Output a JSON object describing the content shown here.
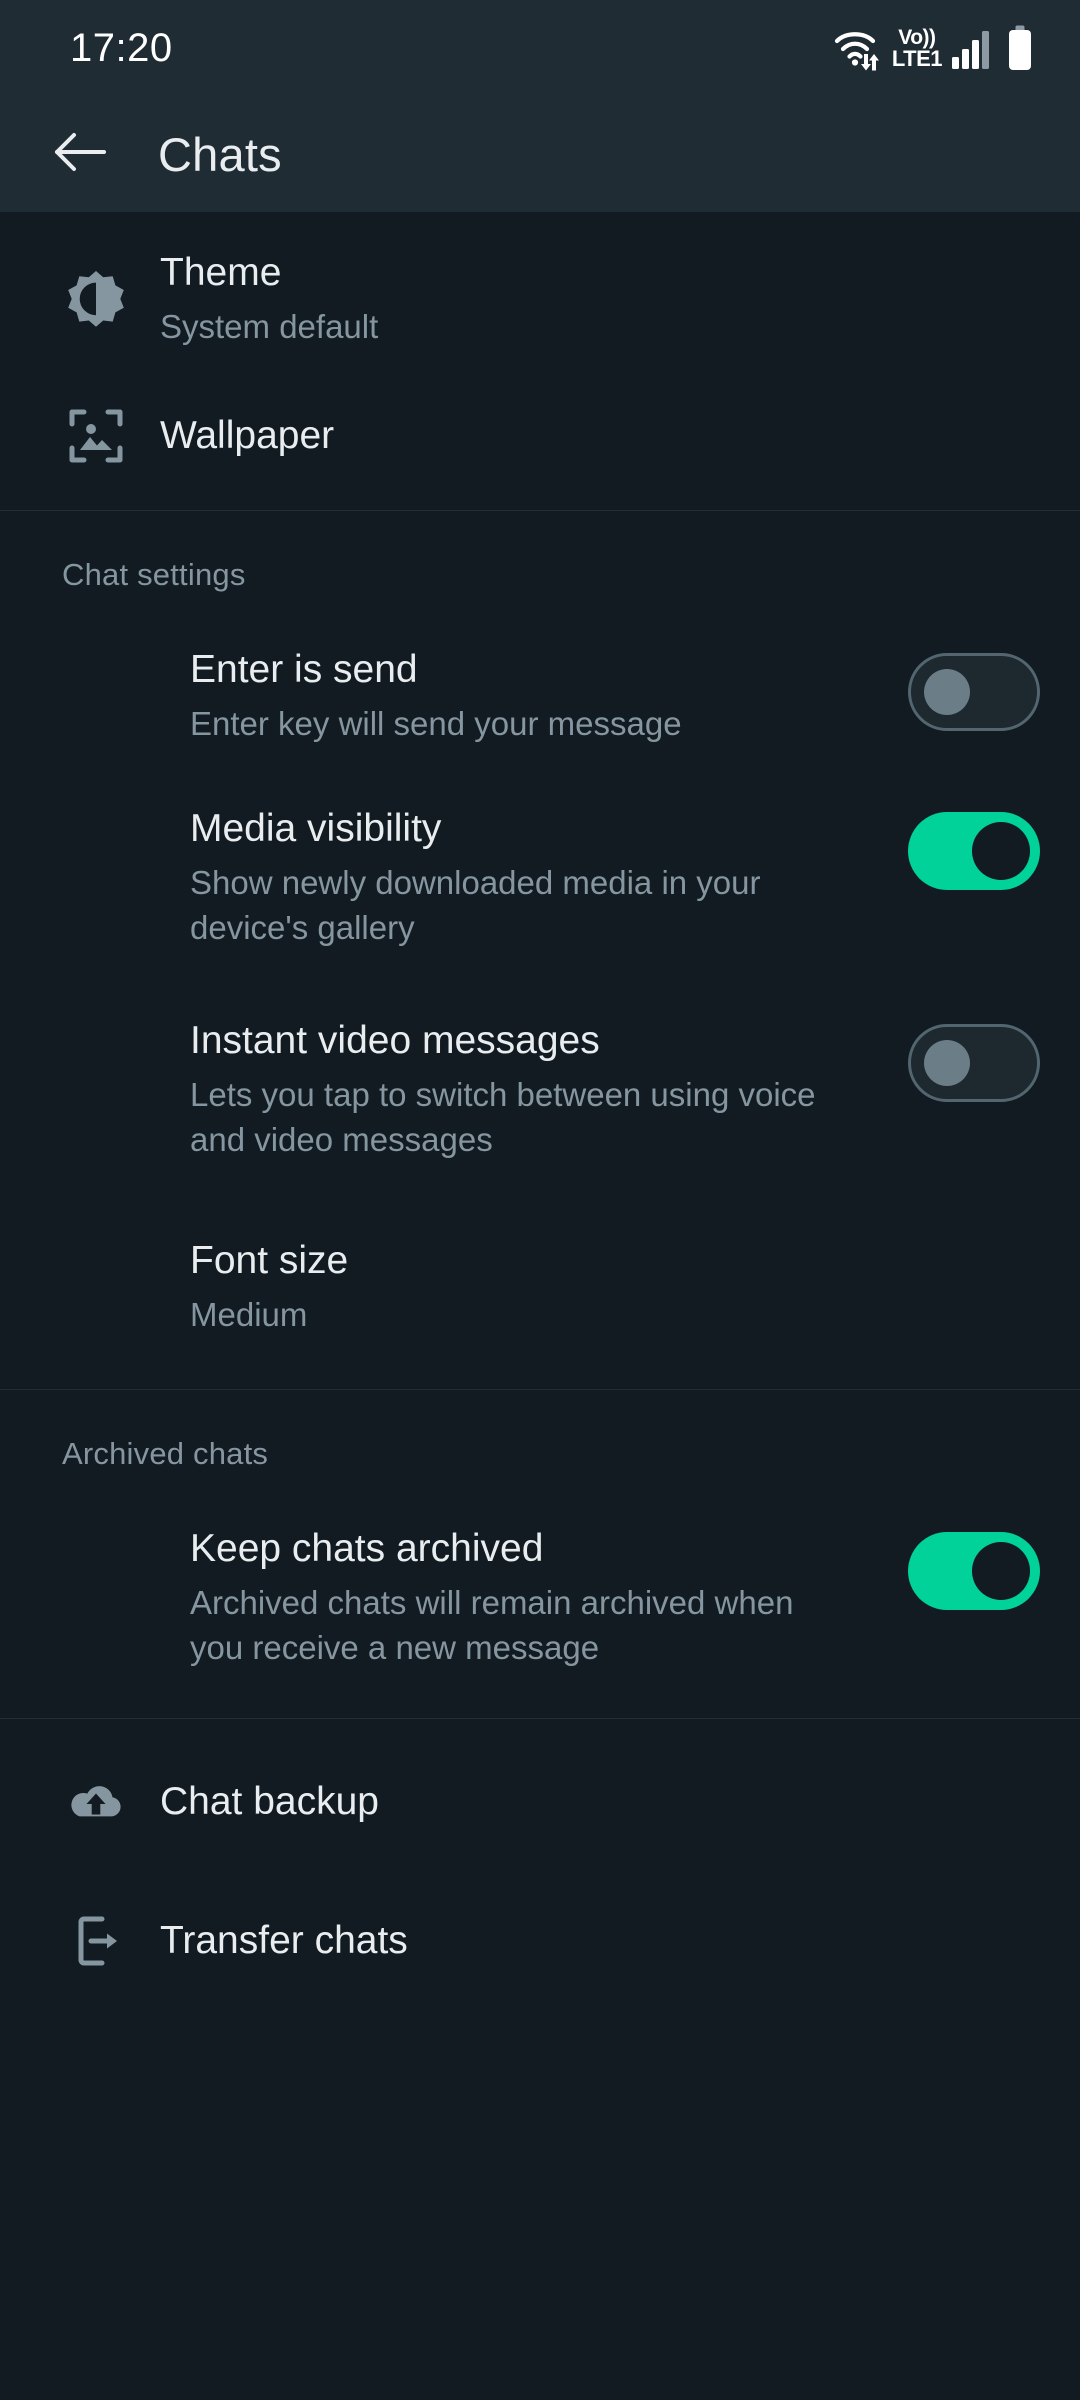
{
  "status_bar": {
    "time": "17:20",
    "icons": [
      "wifi-data-icon",
      "volte-icon",
      "signal-icon",
      "battery-icon"
    ],
    "volte_label_top": "Vo))",
    "volte_label_bottom": "LTE1"
  },
  "app_bar": {
    "back_label": "back-arrow",
    "title": "Chats"
  },
  "display": {
    "items": [
      {
        "icon": "brightness-icon",
        "title": "Theme",
        "subtitle": "System default"
      },
      {
        "icon": "wallpaper-icon",
        "title": "Wallpaper",
        "subtitle": ""
      }
    ]
  },
  "chat_settings": {
    "label": "Chat settings",
    "items": [
      {
        "title": "Enter is send",
        "subtitle": "Enter key will send your message",
        "toggle": "off"
      },
      {
        "title": "Media visibility",
        "subtitle": "Show newly downloaded media in your device's gallery",
        "toggle": "on"
      },
      {
        "title": "Instant video messages",
        "subtitle": "Lets you tap to switch between using voice and video messages",
        "toggle": "off"
      },
      {
        "title": "Font size",
        "subtitle": "Medium",
        "toggle": "none"
      }
    ]
  },
  "archived_chats": {
    "label": "Archived chats",
    "items": [
      {
        "title": "Keep chats archived",
        "subtitle": "Archived chats will remain archived when you receive a new message",
        "toggle": "on"
      }
    ]
  },
  "backup": {
    "items": [
      {
        "icon": "cloud-upload-icon",
        "title": "Chat backup"
      },
      {
        "icon": "phone-transfer-icon",
        "title": "Transfer chats"
      }
    ]
  },
  "colors": {
    "accent_green": "#00d29a",
    "background": "#111b21",
    "app_bar": "#1f2c34",
    "primary_text": "#e9edef",
    "secondary_text": "#8696a0",
    "icon_gray": "#8696a0"
  }
}
